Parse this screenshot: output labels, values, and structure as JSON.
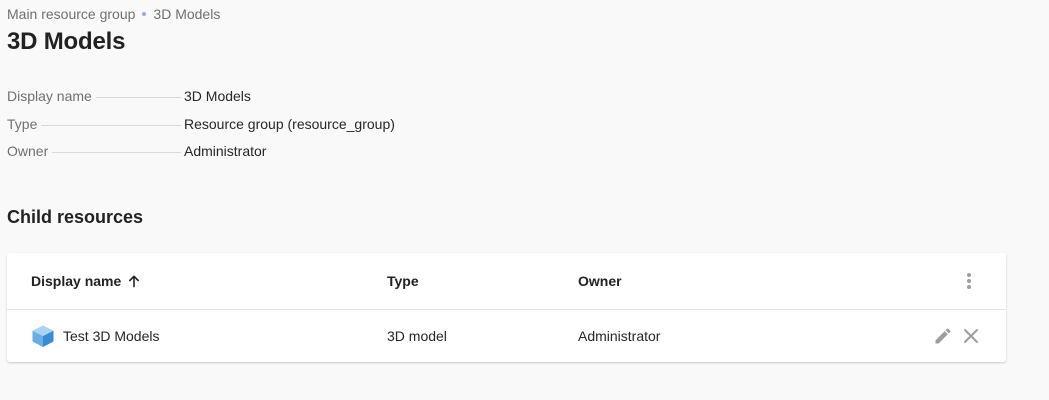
{
  "breadcrumb": {
    "parent": "Main resource group",
    "current": "3D Models"
  },
  "page": {
    "title": "3D Models"
  },
  "properties": [
    {
      "label": "Display name",
      "value": "3D Models"
    },
    {
      "label": "Type",
      "value": "Resource group (resource_group)"
    },
    {
      "label": "Owner",
      "value": "Administrator"
    }
  ],
  "child_resources": {
    "title": "Child resources",
    "columns": {
      "name": "Display name",
      "type": "Type",
      "owner": "Owner"
    },
    "sort": {
      "column": "Display name",
      "direction": "ascending",
      "icon": "arrow-up-icon"
    },
    "rows": [
      {
        "icon": "3d-cube-icon",
        "name": "Test 3D Models",
        "type": "3D model",
        "owner": "Administrator",
        "actions": [
          "edit-icon",
          "delete-icon"
        ]
      }
    ]
  },
  "colors": {
    "background": "#f9f9f9",
    "card": "#ffffff",
    "muted_text": "#707070",
    "icon_gray": "#9e9e9e",
    "cube_light": "#a9d3f2",
    "cube_mid": "#6aaee3",
    "cube_dark": "#3b8bd0"
  }
}
